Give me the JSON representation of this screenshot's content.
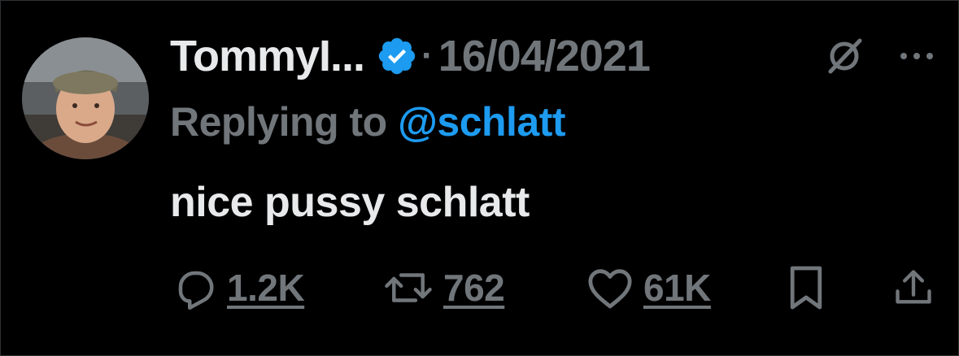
{
  "tweet": {
    "author": {
      "display_name": "TommyI...",
      "verified_icon": "verified-badge-icon",
      "avatar_icon": "avatar"
    },
    "separator": "·",
    "date": "16/04/2021",
    "reply_prefix": "Replying to",
    "reply_to": "@schlatt",
    "text": "nice pussy schlatt",
    "stats": {
      "replies": "1.2K",
      "retweets": "762",
      "likes": "61K"
    }
  },
  "colors": {
    "background": "#000000",
    "text_primary": "#e7e9ea",
    "text_secondary": "#71767b",
    "accent": "#1d9bf0"
  }
}
